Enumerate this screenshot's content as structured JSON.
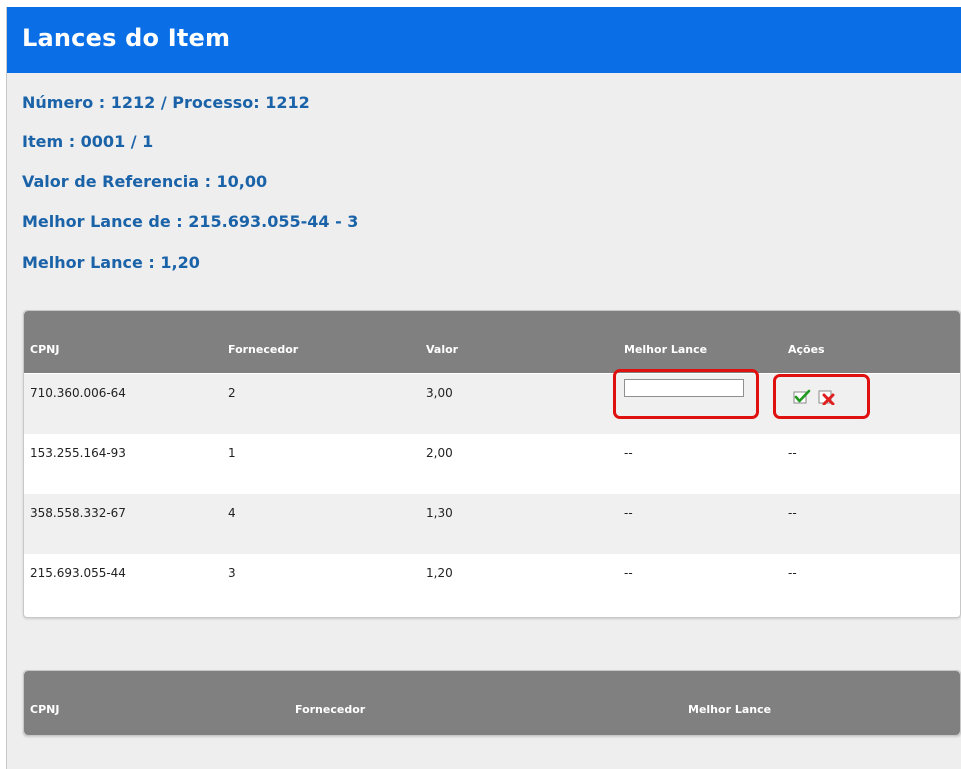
{
  "header": {
    "title": "Lances do Item"
  },
  "info": {
    "numero": "Número : 1212 / Processo: 1212",
    "item": "Item : 0001 / 1",
    "valor_referencia": "Valor de Referencia : 10,00",
    "melhor_lance_de": "Melhor Lance de : 215.693.055-44 - 3",
    "melhor_lance": "Melhor Lance : 1,20"
  },
  "bids_table": {
    "columns": [
      "CPNJ",
      "Fornecedor",
      "Valor",
      "Melhor Lance",
      "Ações"
    ],
    "rows": [
      {
        "cpnj": "710.360.006-64",
        "fornecedor": "2",
        "valor": "3,00",
        "melhor_lance": "",
        "acoes": ""
      },
      {
        "cpnj": "153.255.164-93",
        "fornecedor": "1",
        "valor": "2,00",
        "melhor_lance": "--",
        "acoes": "--"
      },
      {
        "cpnj": "358.558.332-67",
        "fornecedor": "4",
        "valor": "1,30",
        "melhor_lance": "--",
        "acoes": "--"
      },
      {
        "cpnj": "215.693.055-44",
        "fornecedor": "3",
        "valor": "1,20",
        "melhor_lance": "--",
        "acoes": "--"
      }
    ]
  },
  "second_table": {
    "columns": [
      "CPNJ",
      "Fornecedor",
      "Melhor Lance"
    ]
  },
  "colors": {
    "title_bar": "#0a6fe6",
    "info_text": "#1b63a8",
    "table_header": "#808080",
    "highlight": "#e01010"
  },
  "icons": {
    "confirm": "check-icon",
    "cancel": "delete-icon"
  }
}
